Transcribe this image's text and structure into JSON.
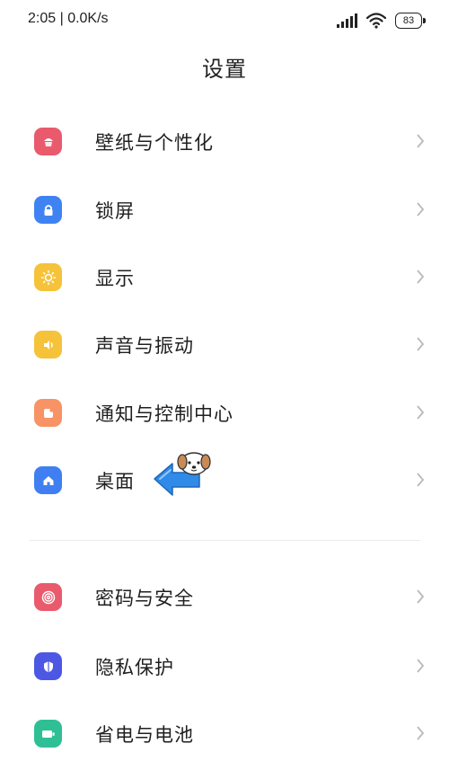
{
  "status_bar": {
    "time": "2:05 | 0.0K/s",
    "battery": "83",
    "signal_icon": "cellular-signal-icon",
    "wifi_icon": "wifi-icon"
  },
  "page": {
    "title": "设置"
  },
  "groups": [
    {
      "items": [
        {
          "label": "壁纸与个性化",
          "icon": "wallpaper-icon",
          "color": "#ea5a6d"
        },
        {
          "label": "锁屏",
          "icon": "lock-icon",
          "color": "#3f83f3"
        },
        {
          "label": "显示",
          "icon": "brightness-icon",
          "color": "#f6c23a"
        },
        {
          "label": "声音与振动",
          "icon": "speaker-icon",
          "color": "#f6c23a"
        },
        {
          "label": "通知与控制中心",
          "icon": "notification-icon",
          "color": "#f79364"
        },
        {
          "label": "桌面",
          "icon": "home-icon",
          "color": "#3f7ff2"
        }
      ]
    },
    {
      "items": [
        {
          "label": "密码与安全",
          "icon": "fingerprint-icon",
          "color": "#ea5a6d"
        },
        {
          "label": "隐私保护",
          "icon": "privacy-shield-icon",
          "color": "#4c58e4"
        },
        {
          "label": "省电与电池",
          "icon": "battery-icon",
          "color": "#2fbf95"
        }
      ]
    }
  ],
  "overlay": {
    "icon": "dog-pointer-arrow-icon",
    "color": "#2f8ae8"
  }
}
